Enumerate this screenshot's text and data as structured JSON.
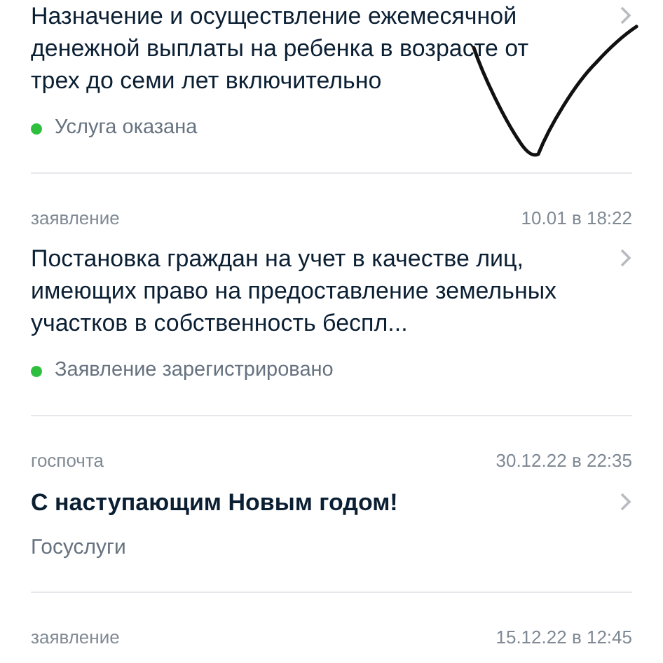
{
  "items": [
    {
      "kind": "application",
      "title": "Назначение и осуществление ежемесячной денежной выплаты на ребенка в возрасте от трех до семи лет включительно",
      "status": "Услуга оказана",
      "color": "#2fbf3f"
    },
    {
      "kind": "application",
      "category": "заявление",
      "date": "10.01 в 18:22",
      "title": "Постановка граждан на учет в качестве лиц, имеющих право на предоставление земельных участков в собственность беспл...",
      "status": "Заявление зарегистрировано",
      "color": "#2fbf3f"
    },
    {
      "kind": "mail",
      "category": "госпочта",
      "date": "30.12.22 в 22:35",
      "title": "С наступающим Новым годом!",
      "sender": "Госуслуги"
    },
    {
      "category": "заявление",
      "date": "15.12.22 в 12:45"
    }
  ]
}
